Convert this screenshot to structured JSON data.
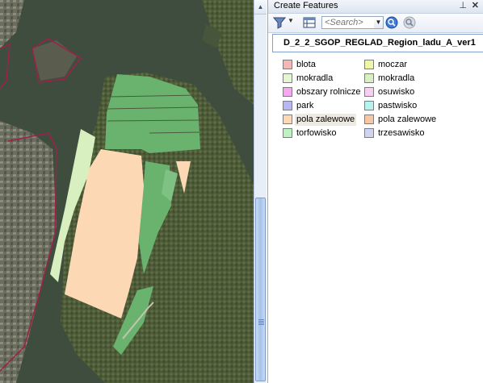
{
  "panel": {
    "title": "Create Features",
    "pin_glyph": "⊥",
    "close_glyph": "✕"
  },
  "toolbar": {
    "organize_icon": "filter-organize-icon",
    "templates_icon": "manage-templates-icon",
    "search_placeholder": "<Search>",
    "search_button_icon": "search-icon",
    "clear_icon": "clear-search-icon"
  },
  "layer": {
    "name": "D_2_2_SGOP_REGLAD_Region_ladu_A_ver1"
  },
  "templates": [
    {
      "label": "blota",
      "color": "#f5b6b6"
    },
    {
      "label": "moczar",
      "color": "#eef7a6"
    },
    {
      "label": "mokradla",
      "color": "#e6f6d2"
    },
    {
      "label": "mokradla",
      "color": "#d8f0c0"
    },
    {
      "label": "obszary rolnicze",
      "color": "#f5a8ef"
    },
    {
      "label": "osuwisko",
      "color": "#f6cff3"
    },
    {
      "label": "park",
      "color": "#b7b7f3"
    },
    {
      "label": "pastwisko",
      "color": "#b6f2ee"
    },
    {
      "label": "pola zalewowe",
      "color": "#fcd9b4",
      "selected": true
    },
    {
      "label": "pola zalewowe",
      "color": "#f6c7a4"
    },
    {
      "label": "torfowisko",
      "color": "#bff2c2"
    },
    {
      "label": "trzesawisko",
      "color": "#cfd5f0"
    }
  ],
  "colors": {
    "map_water": "#3c4b3b",
    "polygon_green": "#6ab36f",
    "polygon_peach": "#fcd9b4",
    "boundary": "#a0204a"
  }
}
